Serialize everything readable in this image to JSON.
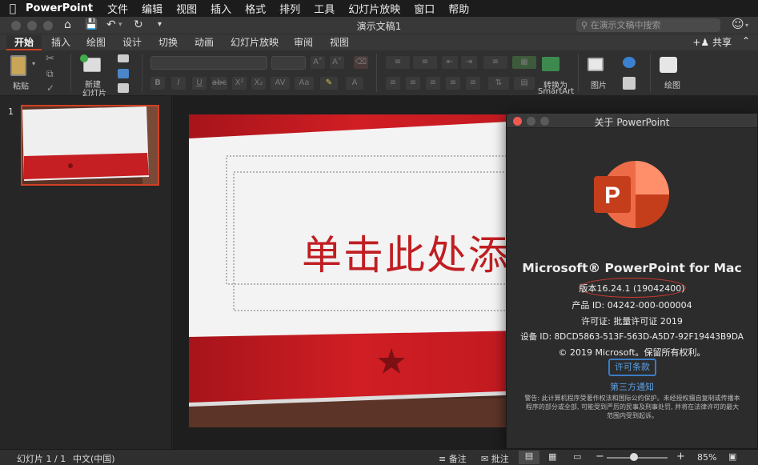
{
  "menubar": {
    "app_name": "PowerPoint",
    "items": [
      "文件",
      "编辑",
      "视图",
      "插入",
      "格式",
      "排列",
      "工具",
      "幻灯片放映",
      "窗口",
      "帮助"
    ]
  },
  "window": {
    "doc_title": "演示文稿1",
    "search_placeholder": "在演示文稿中搜索"
  },
  "ribbon_tabs": {
    "items": [
      "开始",
      "插入",
      "绘图",
      "设计",
      "切换",
      "动画",
      "幻灯片放映",
      "审阅",
      "视图"
    ],
    "active": "开始",
    "share_label": "共享"
  },
  "ribbon": {
    "paste_label": "粘贴",
    "new_slide_label_1": "新建",
    "new_slide_label_2": "幻灯片",
    "convert_label_1": "转换为",
    "convert_label_2": "SmartArt",
    "picture_label": "图片",
    "draw_label": "绘图"
  },
  "thumbnails": {
    "slide_number": "1"
  },
  "slide": {
    "title_placeholder": "单击此处添"
  },
  "about_dialog": {
    "title": "关于 PowerPoint",
    "product": "Microsoft® PowerPoint for Mac",
    "version": "版本16.24.1 (19042400)",
    "product_id": "产品 ID: 04242-000-000004",
    "license": "许可证: 批量许可证 2019",
    "device_id": "设备 ID: 8DCD5863-513F-563D-A5D7-92F19443B9DA",
    "copyright": "© 2019 Microsoft。保留所有权利。",
    "license_terms_button": "许可条款",
    "third_party_link": "第三方通知",
    "warning": "警告: 此计算机程序受著作权法和国际公约保护。未经授权擅自复制或传播本程序的部分或全部, 可能受到严厉的民事及刑事处罚, 并将在法律许可的最大范围内受到起诉。",
    "accent_color": "#d33a2c"
  },
  "statusbar": {
    "slide_count": "幻灯片 1 / 1",
    "language": "中文(中国)",
    "notes_label": "备注",
    "comments_label": "批注",
    "zoom_level": "85%",
    "zoom_fraction": 0.45
  }
}
